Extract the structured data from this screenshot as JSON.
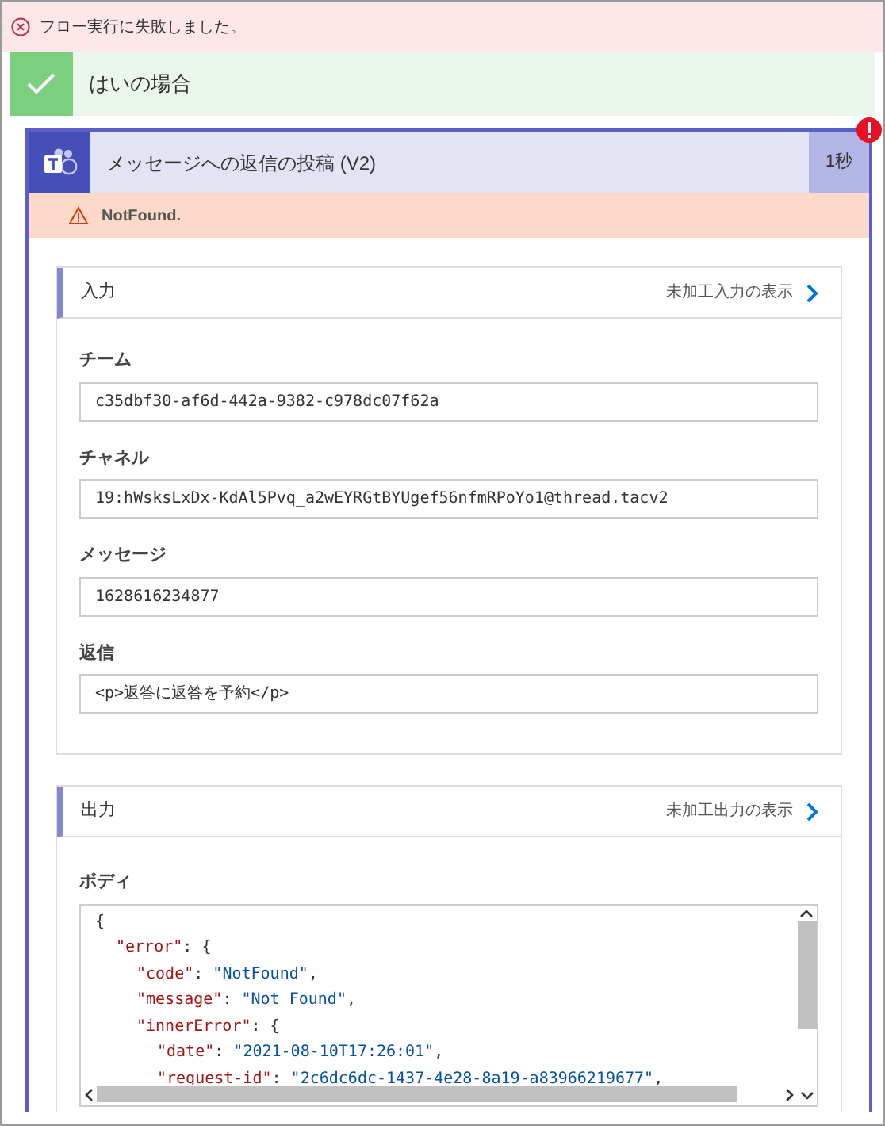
{
  "error_banner": {
    "text": "フロー実行に失敗しました。"
  },
  "condition": {
    "label": "はいの場合",
    "succeeded": true
  },
  "action": {
    "title": "メッセージへの返信の投稿 (V2)",
    "duration": "1秒",
    "has_error": true,
    "error_message": "NotFound.",
    "sections": [
      {
        "title": "入力",
        "link": "未加工入力の表示",
        "fields": [
          {
            "label": "チーム",
            "value": "c35dbf30-af6d-442a-9382-c978dc07f62a"
          },
          {
            "label": "チャネル",
            "value": "19:hWsksLxDx-KdAl5Pvq_a2wEYRGtBYUgef56nfmRPoYo1@thread.tacv2"
          },
          {
            "label": "メッセージ",
            "value": "1628616234877"
          },
          {
            "label": "返信",
            "value": "<p>返答に返答を予約</p>"
          }
        ]
      },
      {
        "title": "出力",
        "link": "未加工出力の表示",
        "body_label": "ボディ",
        "code": [
          {
            "tokens": [
              {
                "kind": "punct",
                "text": "{"
              }
            ],
            "children": [
              {
                "tokens": [
                  {
                    "kind": "key",
                    "text": "\"error\""
                  },
                  {
                    "kind": "punct",
                    "text": ": {"
                  }
                ],
                "children": [
                  {
                    "tokens": [
                      {
                        "kind": "key",
                        "text": "\"code\""
                      },
                      {
                        "kind": "punct",
                        "text": ": "
                      },
                      {
                        "kind": "string",
                        "text": "\"NotFound\""
                      },
                      {
                        "kind": "punct",
                        "text": ","
                      }
                    ]
                  },
                  {
                    "tokens": [
                      {
                        "kind": "key",
                        "text": "\"message\""
                      },
                      {
                        "kind": "punct",
                        "text": ": "
                      },
                      {
                        "kind": "string",
                        "text": "\"Not Found\""
                      },
                      {
                        "kind": "punct",
                        "text": ","
                      }
                    ]
                  },
                  {
                    "tokens": [
                      {
                        "kind": "key",
                        "text": "\"innerError\""
                      },
                      {
                        "kind": "punct",
                        "text": ": {"
                      }
                    ],
                    "children": [
                      {
                        "tokens": [
                          {
                            "kind": "key",
                            "text": "\"date\""
                          },
                          {
                            "kind": "punct",
                            "text": ": "
                          },
                          {
                            "kind": "string",
                            "text": "\"2021-08-10T17:26:01\""
                          },
                          {
                            "kind": "punct",
                            "text": ","
                          }
                        ]
                      },
                      {
                        "tokens": [
                          {
                            "kind": "key",
                            "text": "\"request-id\""
                          },
                          {
                            "kind": "punct",
                            "text": ": "
                          },
                          {
                            "kind": "string",
                            "text": "\"2c6dc6dc-1437-4e28-8a19-a83966219677\""
                          },
                          {
                            "kind": "punct",
                            "text": ","
                          }
                        ]
                      }
                    ]
                  }
                ]
              }
            ]
          }
        ]
      }
    ]
  }
}
